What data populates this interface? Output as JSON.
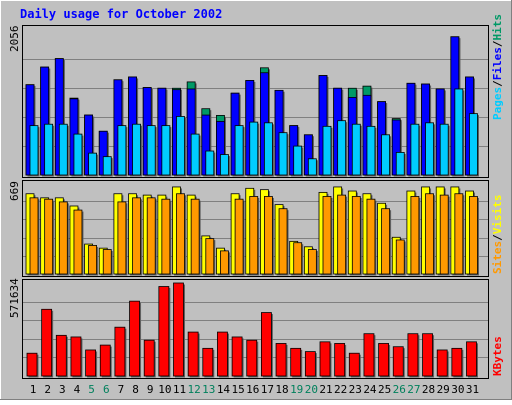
{
  "chart_data": {
    "type": "bar",
    "title": "Daily usage for October 2002",
    "days": [
      "1",
      "2",
      "3",
      "4",
      "5",
      "6",
      "7",
      "8",
      "9",
      "10",
      "11",
      "12",
      "13",
      "14",
      "15",
      "16",
      "17",
      "18",
      "19",
      "20",
      "21",
      "22",
      "23",
      "24",
      "25",
      "26",
      "27",
      "28",
      "29",
      "30",
      "31"
    ],
    "weekend_days": [
      "5",
      "6",
      "12",
      "13",
      "19",
      "20",
      "26",
      "27"
    ],
    "panels": [
      {
        "id": "hits",
        "max_label": "2056",
        "ymax": 2056,
        "series": [
          {
            "name": "Hits",
            "color": "#009966",
            "values": [
              1280,
              1530,
              1650,
              1090,
              850,
              620,
              1350,
              1390,
              1240,
              1230,
              1230,
              1320,
              940,
              845,
              1160,
              1340,
              1520,
              1200,
              700,
              570,
              1410,
              1230,
              1230,
              1260,
              1040,
              800,
              1300,
              1290,
              1220,
              1960,
              1390
            ]
          },
          {
            "name": "Files",
            "color": "#0000ff",
            "values": [
              1280,
              1530,
              1650,
              1080,
              850,
              620,
              1350,
              1390,
              1240,
              1230,
              1210,
              1220,
              850,
              760,
              1160,
              1340,
              1450,
              1200,
              700,
              570,
              1410,
              1230,
              1100,
              1130,
              1040,
              780,
              1300,
              1290,
              1220,
              1960,
              1390
            ]
          },
          {
            "name": "Pages",
            "color": "#00ccff",
            "values": [
              700,
              720,
              720,
              580,
              310,
              260,
              700,
              720,
              700,
              700,
              830,
              580,
              340,
              290,
              700,
              750,
              740,
              600,
              410,
              230,
              690,
              770,
              720,
              690,
              570,
              320,
              720,
              740,
              720,
              1220,
              870
            ]
          }
        ]
      },
      {
        "id": "visits",
        "max_label": "669",
        "ymax": 669,
        "series": [
          {
            "name": "Visits",
            "color": "#ffff00",
            "values": [
              590,
              560,
              560,
              500,
              220,
              190,
              590,
              590,
              580,
              580,
              640,
              580,
              280,
              190,
              590,
              630,
              620,
              510,
              240,
              200,
              600,
              640,
              610,
              590,
              520,
              270,
              610,
              640,
              640,
              640,
              610
            ]
          },
          {
            "name": "Sites",
            "color": "#ff9900",
            "values": [
              560,
              550,
              530,
              470,
              210,
              180,
              530,
              560,
              560,
              550,
              590,
              550,
              260,
              170,
              550,
              570,
              570,
              480,
              230,
              180,
              570,
              580,
              570,
              550,
              480,
              250,
              570,
              590,
              580,
              590,
              570
            ]
          }
        ]
      },
      {
        "id": "kbytes",
        "max_label": "571634",
        "ymax": 571634,
        "series": [
          {
            "name": "KBytes",
            "color": "#ff0000",
            "values": [
              140000,
              410000,
              250000,
              240000,
              160000,
              190000,
              300000,
              460000,
              220000,
              550000,
              571634,
              270000,
              170000,
              270000,
              240000,
              220000,
              390000,
              200000,
              170000,
              150000,
              210000,
              200000,
              140000,
              260000,
              200000,
              180000,
              260000,
              260000,
              160000,
              170000,
              210000
            ]
          }
        ]
      }
    ],
    "legend": {
      "panel1": [
        {
          "text": "Pages",
          "color": "#00ccff"
        },
        {
          "text": "/",
          "color": "#000000"
        },
        {
          "text": "Files",
          "color": "#0000ff"
        },
        {
          "text": "/",
          "color": "#000000"
        },
        {
          "text": "Hits",
          "color": "#009966"
        }
      ],
      "panel2": [
        {
          "text": "Sites",
          "color": "#ff9900"
        },
        {
          "text": "/",
          "color": "#000000"
        },
        {
          "text": "Visits",
          "color": "#ffff00"
        }
      ],
      "panel3": [
        {
          "text": "KBytes",
          "color": "#ff0000"
        }
      ]
    },
    "colors": {
      "background": "#c0c0c0",
      "title": "#0000ff",
      "weekday_label": "#000000",
      "weekend_label": "#00805c",
      "grid": "#808080"
    }
  }
}
